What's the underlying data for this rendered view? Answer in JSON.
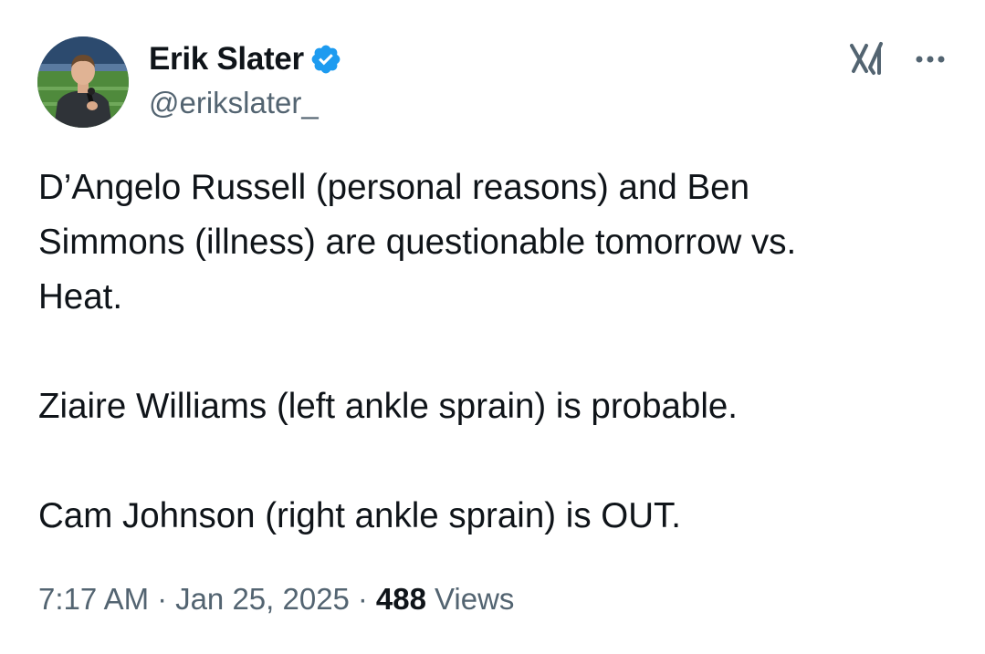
{
  "author": {
    "display_name": "Erik Slater",
    "handle": "@erikslater_",
    "verified": true,
    "verified_color": "#1d9bf0"
  },
  "header_actions": {
    "grok_icon": "grok-icon",
    "more_icon": "more-horizontal-icon"
  },
  "tweet": {
    "lines": [
      "D’Angelo Russell (personal reasons) and Ben",
      "Simmons (illness) are questionable tomorrow vs.",
      "Heat.",
      "Ziaire Williams (left ankle sprain) is probable.",
      "Cam Johnson (right ankle sprain) is OUT."
    ]
  },
  "meta": {
    "time": "7:17 AM",
    "separator": "·",
    "date": "Jan 25, 2025",
    "views_count": "488",
    "views_label": "Views"
  },
  "colors": {
    "text_primary": "#0f1419",
    "text_secondary": "#536471",
    "verified_blue": "#1d9bf0"
  }
}
